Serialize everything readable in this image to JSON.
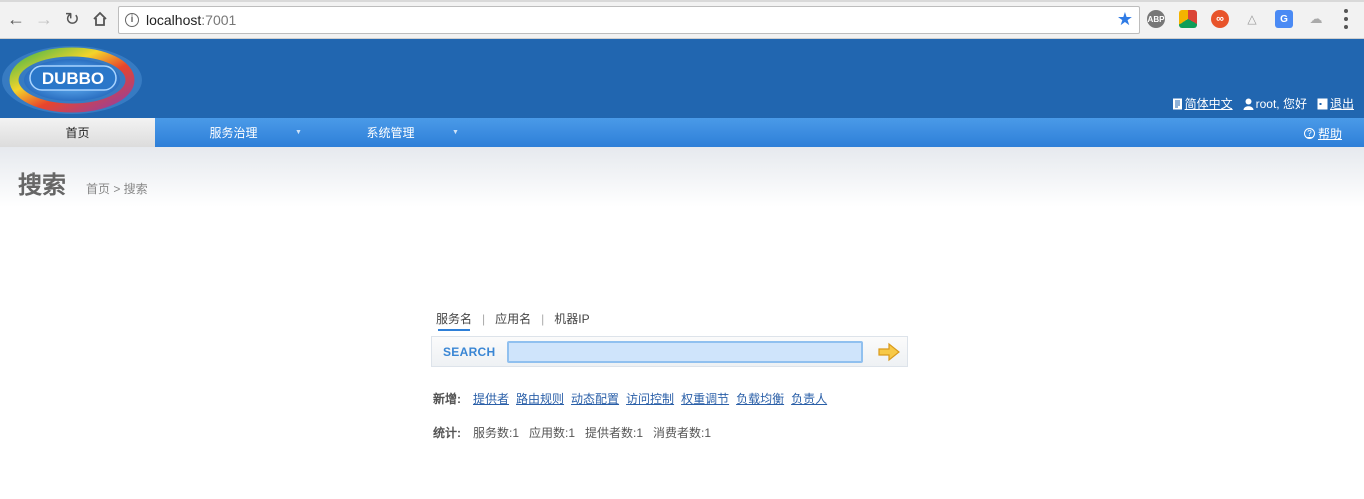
{
  "browser": {
    "url_host": "localhost",
    "url_port": ":7001",
    "extensions": [
      "adblock-icon",
      "chrome-ext-icon",
      "infinity-icon",
      "sitemap-icon",
      "translate-icon",
      "cloud-icon"
    ]
  },
  "header": {
    "logo_text": "DUBBO",
    "language_link": "简体中文",
    "greeting": "root, 您好",
    "logout_link": "退出"
  },
  "menu": {
    "home": "首页",
    "service_gov": "服务治理",
    "system_mgmt": "系统管理",
    "help": "帮助"
  },
  "page": {
    "title": "搜索",
    "breadcrumb": "首页 > 搜索"
  },
  "search": {
    "tabs": [
      "服务名",
      "应用名",
      "机器IP"
    ],
    "label": "SEARCH",
    "value": ""
  },
  "add_row": {
    "label": "新增:",
    "links": [
      "提供者",
      "路由规则",
      "动态配置",
      "访问控制",
      "权重调节",
      "负载均衡",
      "负责人"
    ]
  },
  "stats_row": {
    "label": "统计:",
    "items": [
      "服务数:1",
      "应用数:1",
      "提供者数:1",
      "消费者数:1"
    ]
  },
  "colors": {
    "header_blue": "#2166b0",
    "menu_blue": "#2e7fd8",
    "link_blue": "#2a5fa8"
  }
}
